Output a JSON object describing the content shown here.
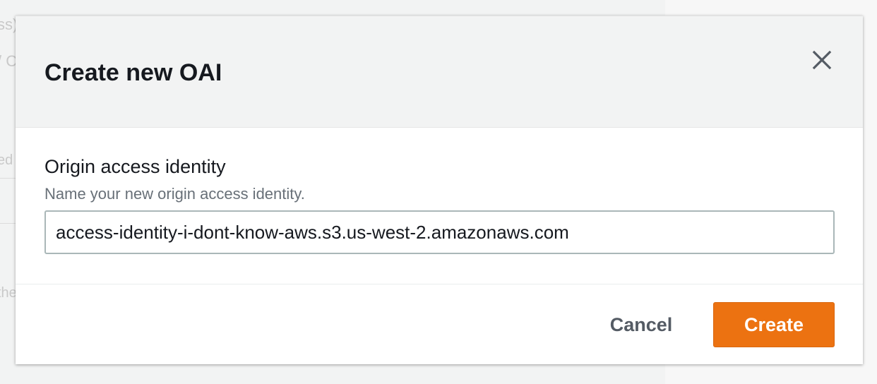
{
  "background": {
    "fragments": [
      "ss)",
      "/ C",
      "ed",
      "the"
    ]
  },
  "modal": {
    "title": "Create new OAI",
    "close_icon": "close-icon",
    "field": {
      "label": "Origin access identity",
      "description": "Name your new origin access identity.",
      "value": "access-identity-i-dont-know-aws.s3.us-west-2.amazonaws.com",
      "placeholder": ""
    },
    "buttons": {
      "cancel_label": "Cancel",
      "create_label": "Create"
    }
  },
  "colors": {
    "primary_button": "#ec7211",
    "header_background": "#f2f3f3",
    "text_primary": "#16191f",
    "text_secondary": "#687078"
  }
}
